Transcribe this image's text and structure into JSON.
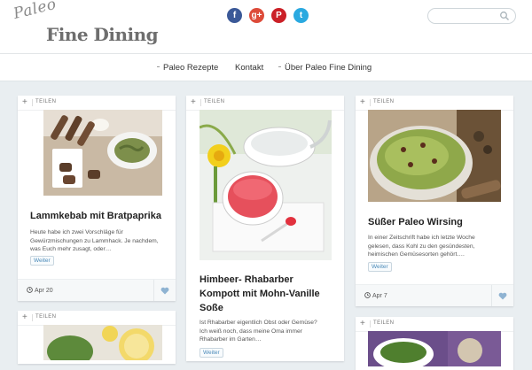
{
  "site": {
    "logo_paleo": "Paleo",
    "logo_main": "Fine Dining"
  },
  "social": [
    {
      "name": "facebook",
      "glyph": "f",
      "color": "#3b5998"
    },
    {
      "name": "google-plus",
      "glyph": "g+",
      "color": "#dd4b39"
    },
    {
      "name": "pinterest",
      "glyph": "P",
      "color": "#cb2027"
    },
    {
      "name": "twitter",
      "glyph": "t",
      "color": "#2aa9e0"
    }
  ],
  "nav": {
    "items": [
      "Paleo Rezepte",
      "Kontakt",
      "Über Paleo Fine Dining"
    ]
  },
  "cards": [
    {
      "share_label": "TEILEN",
      "title": "Lammkebab mit Bratpaprika",
      "excerpt": [
        "Heute habe ich zwei Vorschläge für",
        "Gewürzmischungen zu Lammhack. Je nachdem,",
        "was Euch mehr zusagt, oder…"
      ],
      "more": "Weiter",
      "date": "Apr 20"
    },
    {
      "share_label": "TEILEN",
      "title_lines": [
        "Himbeer- Rhabarber",
        "Kompott mit Mohn-Vanille",
        "Soße"
      ],
      "excerpt": [
        "Ist Rhabarber eigentlich Obst oder Gemüse?",
        "Ich weiß noch, dass meine Oma immer",
        "Rhabarber im Garten…"
      ],
      "more": "Weiter"
    },
    {
      "share_label": "TEILEN",
      "title": "Süßer Paleo Wirsing",
      "excerpt": [
        "In einer Zeitschrift habe ich letzte Woche",
        "gelesen, dass Kohl zu den gesündesten,",
        "heimischen Gemüsesorten gehört…."
      ],
      "more": "Weiter",
      "date": "Apr 7"
    },
    {
      "share_label": "TEILEN"
    },
    {
      "share_label": "TEILEN"
    }
  ]
}
